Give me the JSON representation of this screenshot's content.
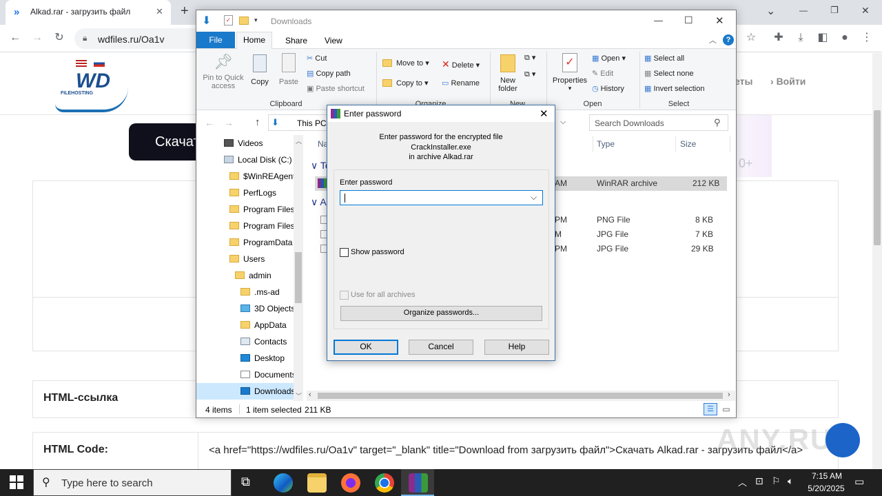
{
  "browser": {
    "tab_title": "Alkad.rar - загрузить файл",
    "url": "wdfiles.ru/Oa1v",
    "new_tab": "+",
    "window_controls": [
      "⌄",
      "—",
      "❐",
      "✕"
    ]
  },
  "site": {
    "logo_text": "WD",
    "logo_sub": "FILEHOSTING",
    "download_btn": "Скачат",
    "nav_partial": "еты",
    "login": "Войти",
    "partial_right": "0+",
    "html_link_label": "HTML-ссылка",
    "html_code_label": "HTML Code:",
    "html_code_value": "<a href=\"https://wdfiles.ru/Oa1v\" target=\"_blank\" title=\"Download from загрузить файл\">Скачать Alkad.rar - загрузить файл</a>",
    "watermark": "ANY.RUN"
  },
  "explorer": {
    "title": "Downloads",
    "tabs": [
      "File",
      "Home",
      "Share",
      "View"
    ],
    "active_tab": "Home",
    "clipboard": {
      "pin": "Pin to Quick access",
      "copy": "Copy",
      "paste": "Paste",
      "cut": "Cut",
      "copy_path": "Copy path",
      "paste_shortcut": "Paste shortcut",
      "group": "Clipboard"
    },
    "organize": {
      "move_to": "Move to",
      "copy_to": "Copy to",
      "delete": "Delete",
      "rename": "Rename",
      "group": "Organize"
    },
    "new": {
      "new_folder": "New folder",
      "group": "New"
    },
    "open": {
      "properties": "Properties",
      "open": "Open",
      "edit": "Edit",
      "history": "History",
      "group": "Open"
    },
    "select": {
      "select_all": "Select all",
      "select_none": "Select none",
      "invert": "Invert selection",
      "group": "Select"
    },
    "address": "This PC",
    "search_placeholder": "Search Downloads",
    "nav_tree": [
      {
        "label": "Videos",
        "indent": 0,
        "icon": "video-icon"
      },
      {
        "label": "Local Disk (C:)",
        "indent": 0,
        "icon": "disk-icon"
      },
      {
        "label": "$WinREAgent",
        "indent": 1,
        "icon": "folder-icon"
      },
      {
        "label": "PerfLogs",
        "indent": 1,
        "icon": "folder-icon"
      },
      {
        "label": "Program Files",
        "indent": 1,
        "icon": "folder-icon"
      },
      {
        "label": "Program Files",
        "indent": 1,
        "icon": "folder-icon"
      },
      {
        "label": "ProgramData",
        "indent": 1,
        "icon": "folder-icon"
      },
      {
        "label": "Users",
        "indent": 1,
        "icon": "folder-icon"
      },
      {
        "label": "admin",
        "indent": 2,
        "icon": "folder-icon"
      },
      {
        "label": ".ms-ad",
        "indent": 3,
        "icon": "folder-icon"
      },
      {
        "label": "3D Objects",
        "indent": 3,
        "icon": "cube-icon"
      },
      {
        "label": "AppData",
        "indent": 3,
        "icon": "folder-icon"
      },
      {
        "label": "Contacts",
        "indent": 3,
        "icon": "contacts-icon"
      },
      {
        "label": "Desktop",
        "indent": 3,
        "icon": "desktop-icon"
      },
      {
        "label": "Documents",
        "indent": 3,
        "icon": "documents-icon"
      },
      {
        "label": "Downloads",
        "indent": 3,
        "icon": "download-arrow-icon"
      }
    ],
    "columns": {
      "name": "Na",
      "type": "Type",
      "size": "Size"
    },
    "groups": [
      "To",
      "A"
    ],
    "files": [
      {
        "date_tail": "AM",
        "type": "WinRAR archive",
        "size": "212 KB",
        "selected": true
      },
      {
        "date_tail": "PM",
        "type": "PNG File",
        "size": "8 KB",
        "selected": false
      },
      {
        "date_tail": "M",
        "type": "JPG File",
        "size": "7 KB",
        "selected": false
      },
      {
        "date_tail": "PM",
        "type": "JPG File",
        "size": "29 KB",
        "selected": false
      }
    ],
    "status": {
      "items": "4 items",
      "selected": "1 item selected",
      "size": "211 KB"
    }
  },
  "dialog": {
    "title": "Enter password",
    "message_line1": "Enter password for the encrypted file",
    "message_line2": "CrackInstaller.exe",
    "message_line3": "in archive Alkad.rar",
    "field_label": "Enter password",
    "field_value": "",
    "show_password": "Show password",
    "use_all": "Use for all archives",
    "organize": "Organize passwords...",
    "ok": "OK",
    "cancel": "Cancel",
    "help": "Help"
  },
  "taskbar": {
    "search_placeholder": "Type here to search",
    "time": "7:15 AM",
    "date": "5/20/2025"
  },
  "colors": {
    "accent": "#1a73e8",
    "ribbon_file": "#1979ca",
    "selection": "#cce8ff",
    "dialog_border": "#3c6fa5"
  }
}
